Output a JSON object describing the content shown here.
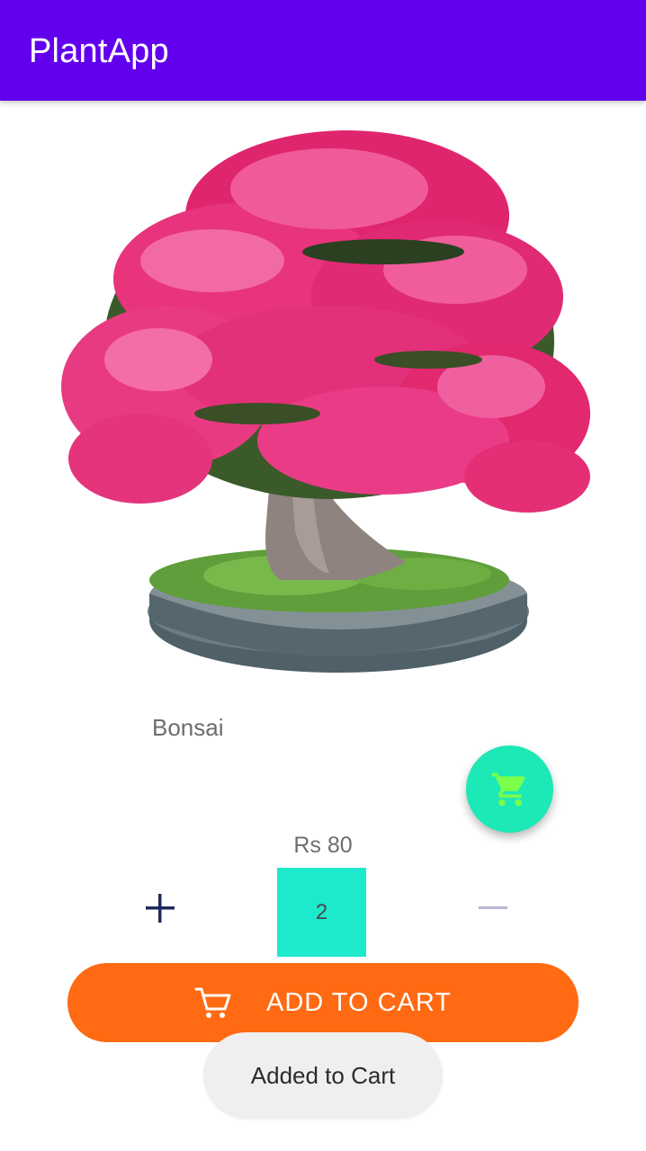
{
  "app": {
    "title": "PlantApp"
  },
  "colors": {
    "app_bar": "#6200ee",
    "fab": "#1de9b6",
    "fab_icon": "#7cff4a",
    "quantity_box": "#1de9cc",
    "add_to_cart": "#ff6a13",
    "toast_bg": "#efefef"
  },
  "product": {
    "image_icon": "bonsai-tree-image",
    "name": "Bonsai",
    "price": "Rs 80"
  },
  "fab": {
    "icon": "shopping-cart-icon"
  },
  "quantity": {
    "plus_icon": "plus-icon",
    "value": "2",
    "minus_icon": "minus-icon"
  },
  "add_to_cart": {
    "label": "ADD TO CART",
    "icon": "cart-outline-icon"
  },
  "toast": {
    "message": "Added to Cart"
  }
}
